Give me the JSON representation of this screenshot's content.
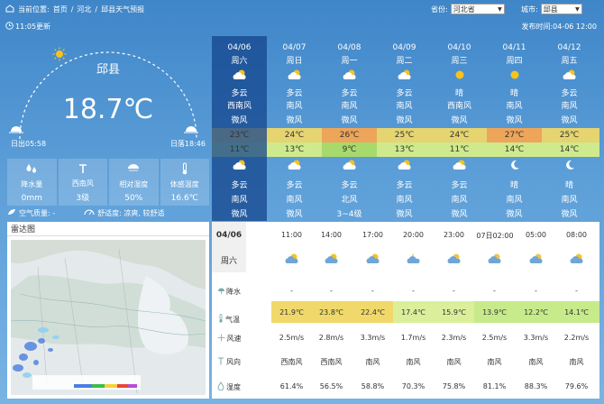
{
  "header": {
    "location_label": "当前位置:",
    "breadcrumb": [
      "首页",
      "/",
      "河北",
      "/",
      "邱县天气预报"
    ],
    "province_label": "省份:",
    "province_value": "河北省",
    "city_label": "城市:",
    "city_value": "邱县",
    "update_text": "11:05更新",
    "publish_text": "发布时间:04-06 12:00"
  },
  "current": {
    "city": "邱县",
    "temp": "18.7℃",
    "sunrise": "日出05:58",
    "sunset": "日落18:46",
    "stats": [
      {
        "icon": "droplets-icon",
        "label": "降水量",
        "value": "0mm"
      },
      {
        "icon": "wind-direction-icon",
        "label": "西南风",
        "value": "3级"
      },
      {
        "icon": "humidity-icon",
        "label": "相对湿度",
        "value": "50%"
      },
      {
        "icon": "thermometer-icon",
        "label": "体感温度",
        "value": "16.6℃"
      }
    ],
    "air_quality": "空气质量: -",
    "comfort": "舒适度: 凉爽, 较舒适"
  },
  "radar": {
    "title": "雷达图"
  },
  "days": [
    {
      "date": "04/06",
      "week": "周六",
      "day_weather": "多云",
      "day_icon": "cloudy-icon",
      "day_wind_dir": "西南风",
      "day_wind": "微风",
      "high": "23℃",
      "low": "11℃",
      "night_weather": "多云",
      "night_icon": "cloudy-icon",
      "night_wind_dir": "南风",
      "night_wind": "微风"
    },
    {
      "date": "04/07",
      "week": "周日",
      "day_weather": "多云",
      "day_icon": "cloudy-icon",
      "day_wind_dir": "南风",
      "day_wind": "微风",
      "high": "24℃",
      "low": "13℃",
      "night_weather": "多云",
      "night_icon": "cloudy-icon",
      "night_wind_dir": "南风",
      "night_wind": "微风"
    },
    {
      "date": "04/08",
      "week": "周一",
      "day_weather": "多云",
      "day_icon": "cloudy-icon",
      "day_wind_dir": "南风",
      "day_wind": "微风",
      "high": "26℃",
      "low": "9℃",
      "night_weather": "多云",
      "night_icon": "cloudy-icon",
      "night_wind_dir": "北风",
      "night_wind": "3~4级"
    },
    {
      "date": "04/09",
      "week": "周二",
      "day_weather": "多云",
      "day_icon": "cloudy-icon",
      "day_wind_dir": "南风",
      "day_wind": "微风",
      "high": "25℃",
      "low": "13℃",
      "night_weather": "多云",
      "night_icon": "cloudy-icon",
      "night_wind_dir": "南风",
      "night_wind": "微风"
    },
    {
      "date": "04/10",
      "week": "周三",
      "day_weather": "晴",
      "day_icon": "sunny-icon",
      "day_wind_dir": "西南风",
      "day_wind": "微风",
      "high": "24℃",
      "low": "11℃",
      "night_weather": "多云",
      "night_icon": "cloudy-icon",
      "night_wind_dir": "南风",
      "night_wind": "微风"
    },
    {
      "date": "04/11",
      "week": "周四",
      "day_weather": "晴",
      "day_icon": "sunny-icon",
      "day_wind_dir": "南风",
      "day_wind": "微风",
      "high": "27℃",
      "low": "14℃",
      "night_weather": "晴",
      "night_icon": "sunny-icon",
      "night_wind_dir": "南风",
      "night_wind": "微风"
    },
    {
      "date": "04/12",
      "week": "周五",
      "day_weather": "多云",
      "day_icon": "cloudy-icon",
      "day_wind_dir": "南风",
      "day_wind": "微风",
      "high": "25℃",
      "low": "14℃",
      "night_weather": "晴",
      "night_icon": "sunny-icon",
      "night_wind_dir": "南风",
      "night_wind": "微风"
    }
  ],
  "hourly": {
    "date": "04/06",
    "week": "周六",
    "times": [
      "11:00",
      "14:00",
      "17:00",
      "20:00",
      "23:00",
      "07日02:00",
      "05:00",
      "08:00"
    ],
    "row_labels": {
      "precip": "降水",
      "temp": "气温",
      "wind_speed": "风速",
      "wind_dir": "风向",
      "humidity": "湿度"
    },
    "precip": [
      "-",
      "-",
      "-",
      "-",
      "-",
      "-",
      "-",
      "-"
    ],
    "temp": [
      "21.9℃",
      "23.8℃",
      "22.4℃",
      "17.4℃",
      "15.9℃",
      "13.9℃",
      "12.2℃",
      "14.1℃"
    ],
    "wind_speed": [
      "2.5m/s",
      "2.8m/s",
      "3.3m/s",
      "1.7m/s",
      "2.3m/s",
      "2.5m/s",
      "3.3m/s",
      "2.2m/s"
    ],
    "wind_dir": [
      "西南风",
      "西南风",
      "南风",
      "南风",
      "南风",
      "南风",
      "南风",
      "南风"
    ],
    "humidity": [
      "61.4%",
      "56.5%",
      "58.8%",
      "70.3%",
      "75.8%",
      "81.1%",
      "88.3%",
      "79.6%"
    ],
    "icons": [
      "cloudy-icon",
      "cloudy-icon",
      "cloudy-icon",
      "partly-cloudy-night-icon",
      "cloudy-icon",
      "cloudy-icon",
      "cloudy-icon",
      "cloudy-icon"
    ]
  },
  "colors": {
    "high_band": "#e6d470",
    "high_band_peak": "#eda55a",
    "low_band": "#cfe98d",
    "warm_cell": "#f0d96a",
    "cool_cell": "#c7ea8a"
  }
}
